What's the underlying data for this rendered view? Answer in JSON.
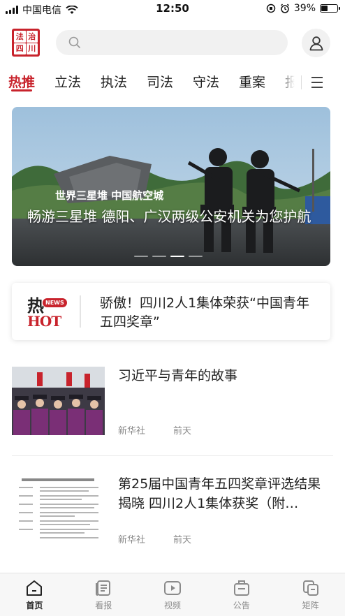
{
  "status_bar": {
    "carrier": "中国电信",
    "time": "12:50",
    "battery": "39%",
    "battery_level": 0.39
  },
  "header": {
    "logo_chars": [
      "法",
      "治",
      "四",
      "川"
    ],
    "search_placeholder": "",
    "icons": {
      "search": "search-icon",
      "profile": "user-icon"
    }
  },
  "tabs": {
    "items": [
      "热推",
      "立法",
      "执法",
      "司法",
      "守法",
      "重案",
      "报"
    ],
    "active_index": 0,
    "menu_icon": "menu-icon"
  },
  "banner": {
    "title": "畅游三星堆 德阳、广汉两级公安机关为您护航",
    "image_text": "世界三星堆 中国航空城",
    "slide_count": 4,
    "active_slide": 2
  },
  "hot": {
    "label_re": "热",
    "label_news": "NEWS",
    "label_hot": "HOT",
    "headline": "骄傲！四川2人1集体荣获“中国青年五四奖章”"
  },
  "news": [
    {
      "title": "习近平与青年的故事",
      "source": "新华社",
      "time": "前天"
    },
    {
      "title": "第25届中国青年五四奖章评选结果揭晓 四川2人1集体获奖（附…",
      "source": "新华社",
      "time": "前天"
    }
  ],
  "bottom_nav": {
    "items": [
      {
        "label": "首页",
        "icon": "home-icon"
      },
      {
        "label": "看报",
        "icon": "newspaper-icon"
      },
      {
        "label": "视频",
        "icon": "video-icon"
      },
      {
        "label": "公告",
        "icon": "announcement-icon"
      },
      {
        "label": "矩阵",
        "icon": "matrix-icon"
      }
    ],
    "active_index": 0
  },
  "colors": {
    "accent": "#c8232c",
    "muted": "#888888"
  }
}
